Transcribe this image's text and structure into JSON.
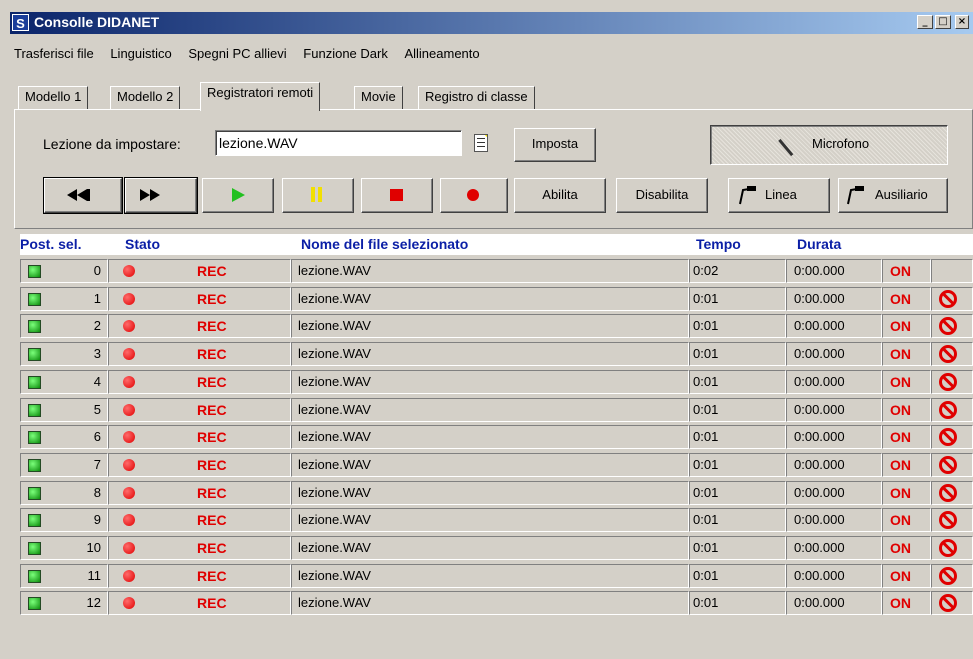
{
  "window": {
    "title": "Consolle DIDANET",
    "app_icon": "S",
    "controls": {
      "minimize": "_",
      "maximize": "□",
      "close": "×"
    }
  },
  "menu": [
    "Trasferisci file",
    "Linguistico",
    "Spegni PC allievi",
    "Funzione Dark",
    "Allineamento"
  ],
  "tabs": [
    {
      "label": "Modello 1",
      "active": false
    },
    {
      "label": "Modello 2",
      "active": false
    },
    {
      "label": "Registratori remoti",
      "active": true
    },
    {
      "label": "Movie",
      "active": false
    },
    {
      "label": "Registro di classe",
      "active": false
    }
  ],
  "lesson": {
    "label": "Lezione da impostare:",
    "value": "lezione.WAV",
    "set_button": "Imposta"
  },
  "transport": {
    "rewind_icon": "fast-rewind-icon",
    "forward_icon": "fast-forward-icon",
    "play_icon": "play-icon",
    "pause_icon": "pause-icon",
    "stop_icon": "stop-icon",
    "record_icon": "record-icon",
    "enable": "Abilita",
    "disable": "Disabilita"
  },
  "sources": {
    "microphone": "Microfono",
    "line": "Linea",
    "aux": "Ausiliario"
  },
  "table": {
    "headers": {
      "post": "Post. sel.",
      "status": "Stato",
      "filename": "Nome del file selezionato",
      "time": "Tempo",
      "duration": "Durata"
    },
    "rows": [
      {
        "num": "0",
        "status": "REC",
        "file": "lezione.WAV",
        "time": "0:02",
        "duration": "0:00.000",
        "state": "ON",
        "blocked": false
      },
      {
        "num": "1",
        "status": "REC",
        "file": "lezione.WAV",
        "time": "0:01",
        "duration": "0:00.000",
        "state": "ON",
        "blocked": true
      },
      {
        "num": "2",
        "status": "REC",
        "file": "lezione.WAV",
        "time": "0:01",
        "duration": "0:00.000",
        "state": "ON",
        "blocked": true
      },
      {
        "num": "3",
        "status": "REC",
        "file": "lezione.WAV",
        "time": "0:01",
        "duration": "0:00.000",
        "state": "ON",
        "blocked": true
      },
      {
        "num": "4",
        "status": "REC",
        "file": "lezione.WAV",
        "time": "0:01",
        "duration": "0:00.000",
        "state": "ON",
        "blocked": true
      },
      {
        "num": "5",
        "status": "REC",
        "file": "lezione.WAV",
        "time": "0:01",
        "duration": "0:00.000",
        "state": "ON",
        "blocked": true
      },
      {
        "num": "6",
        "status": "REC",
        "file": "lezione.WAV",
        "time": "0:01",
        "duration": "0:00.000",
        "state": "ON",
        "blocked": true
      },
      {
        "num": "7",
        "status": "REC",
        "file": "lezione.WAV",
        "time": "0:01",
        "duration": "0:00.000",
        "state": "ON",
        "blocked": true
      },
      {
        "num": "8",
        "status": "REC",
        "file": "lezione.WAV",
        "time": "0:01",
        "duration": "0:00.000",
        "state": "ON",
        "blocked": true
      },
      {
        "num": "9",
        "status": "REC",
        "file": "lezione.WAV",
        "time": "0:01",
        "duration": "0:00.000",
        "state": "ON",
        "blocked": true
      },
      {
        "num": "10",
        "status": "REC",
        "file": "lezione.WAV",
        "time": "0:01",
        "duration": "0:00.000",
        "state": "ON",
        "blocked": true
      },
      {
        "num": "11",
        "status": "REC",
        "file": "lezione.WAV",
        "time": "0:01",
        "duration": "0:00.000",
        "state": "ON",
        "blocked": true
      },
      {
        "num": "12",
        "status": "REC",
        "file": "lezione.WAV",
        "time": "0:01",
        "duration": "0:00.000",
        "state": "ON",
        "blocked": true
      }
    ]
  },
  "colors": {
    "title_gradient_start": "#0a246a",
    "title_gradient_end": "#a6caf0",
    "header_text": "#0b1fa6",
    "rec_red": "#e00000",
    "play_green": "#22c020",
    "pause_yellow": "#f2e000",
    "led_green": "#0b8a0b"
  }
}
